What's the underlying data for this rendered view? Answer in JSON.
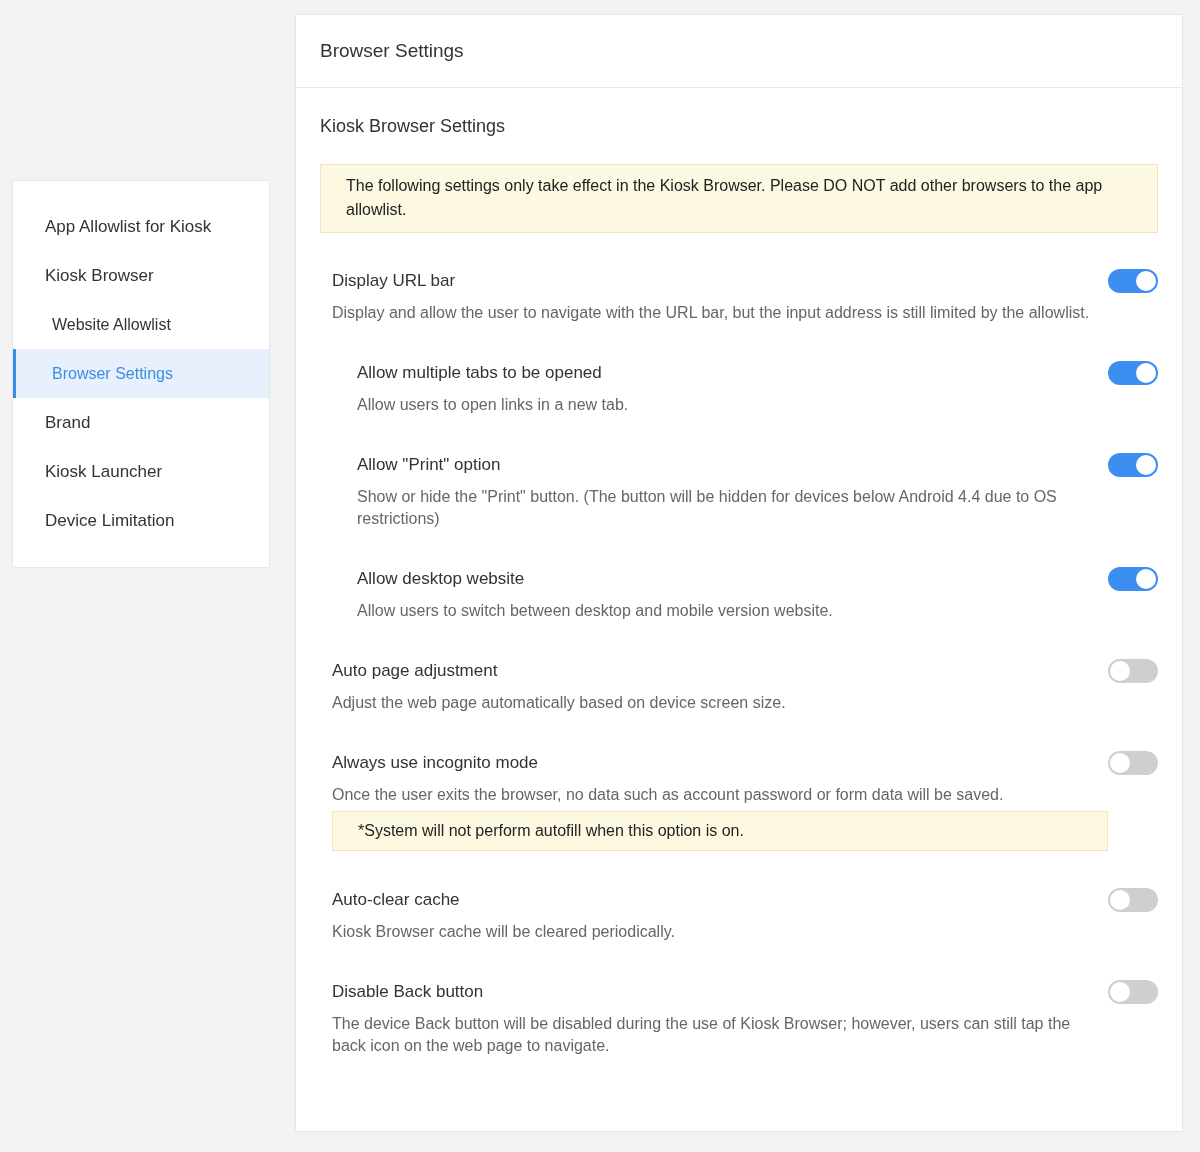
{
  "sidebar": {
    "items": [
      {
        "label": "App Allowlist for Kiosk",
        "selected": false
      },
      {
        "label": "Kiosk Browser",
        "selected": false,
        "children": [
          {
            "label": "Website Allowlist",
            "selected": false
          },
          {
            "label": "Browser Settings",
            "selected": true
          }
        ]
      },
      {
        "label": "Brand",
        "selected": false
      },
      {
        "label": "Kiosk Launcher",
        "selected": false
      },
      {
        "label": "Device Limitation",
        "selected": false
      }
    ]
  },
  "panel": {
    "title": "Browser Settings",
    "section_title": "Kiosk Browser Settings",
    "notice": "The following settings only take effect in the Kiosk Browser. Please DO NOT add other browsers to the app allowlist.",
    "settings": [
      {
        "title": "Display URL bar",
        "description": "Display and allow the user to navigate with the URL bar, but the input address is still limited by the allowlist.",
        "on": true,
        "children": [
          {
            "title": "Allow multiple tabs to be opened",
            "description": "Allow users to open links in a new tab.",
            "on": true
          },
          {
            "title": "Allow \"Print\" option",
            "description": "Show or hide the \"Print\" button. (The button will be hidden for devices below Android 4.4 due to OS restrictions)",
            "on": true
          },
          {
            "title": "Allow desktop website",
            "description": "Allow users to switch between desktop and mobile version website.",
            "on": true
          }
        ]
      },
      {
        "title": "Auto page adjustment",
        "description": "Adjust the web page automatically based on device screen size.",
        "on": false
      },
      {
        "title": "Always use incognito mode",
        "description": "Once the user exits the browser, no data such as account password or form data will be saved.",
        "on": false,
        "note": "*System will not perform autofill when this option is on."
      },
      {
        "title": "Auto-clear cache",
        "description": "Kiosk Browser cache will be cleared periodically.",
        "on": false
      },
      {
        "title": "Disable Back button",
        "description": "The device Back button will be disabled during the use of Kiosk Browser; however, users can still tap the back icon on the web page to navigate.",
        "on": false
      }
    ]
  }
}
